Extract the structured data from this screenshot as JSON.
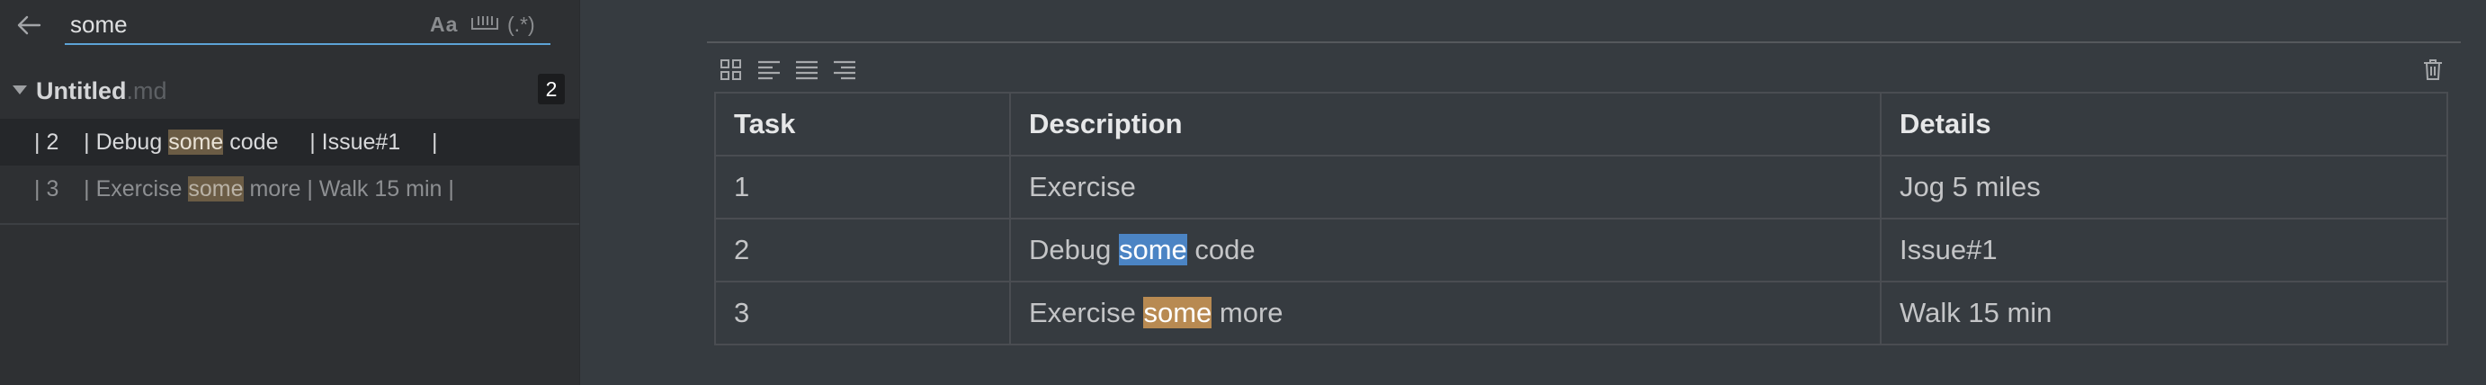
{
  "search": {
    "query": "some",
    "case_label": "Aa",
    "regex_label": "(.*)"
  },
  "file": {
    "name": "Untitled",
    "ext": ".md",
    "match_count": "2"
  },
  "results": [
    {
      "pre": "| 2    | Debug ",
      "match": "some",
      "post": " code     | Issue#1     |"
    },
    {
      "pre": "| 3    | Exercise ",
      "match": "some",
      "post": " more | Walk 15 min |"
    }
  ],
  "table": {
    "headers": [
      "Task",
      "Description",
      "Details"
    ],
    "rows": [
      {
        "task": "1",
        "desc_pre": "Exercise",
        "desc_match": "",
        "desc_post": "",
        "details": "Jog 5 miles"
      },
      {
        "task": "2",
        "desc_pre": "Debug ",
        "desc_match": "some",
        "desc_post": " code",
        "details": "Issue#1"
      },
      {
        "task": "3",
        "desc_pre": "Exercise ",
        "desc_match": "some",
        "desc_post": " more",
        "details": "Walk 15 min"
      }
    ]
  },
  "colors": {
    "sidebar_bg": "#2E3033",
    "editor_bg": "#363B40",
    "current_match": "#4b84c4",
    "other_match": "#b88a52",
    "search_underline": "#5da3d6"
  },
  "icons": [
    "back-arrow-icon",
    "whole-word-icon",
    "table-grid-icon",
    "align-left-icon",
    "align-center-icon",
    "align-right-icon",
    "trash-icon"
  ]
}
